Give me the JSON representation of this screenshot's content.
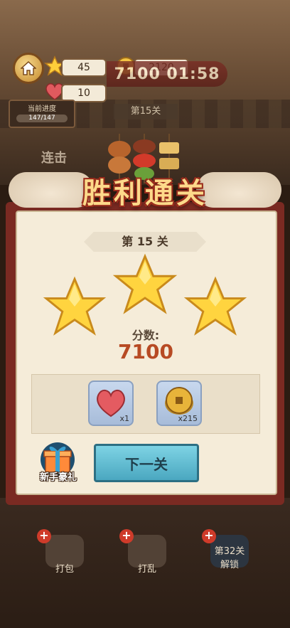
{
  "hud": {
    "stars": "45",
    "coins": "2120",
    "hearts": "10",
    "score_banner": "7100 01:58",
    "progress_label": "当前进度",
    "progress_value": "147/147",
    "level_label": "第15关"
  },
  "background": {
    "combo_text": "连击"
  },
  "result": {
    "title": "胜利通关",
    "level": "第 15 关",
    "stars_earned": 3,
    "score_label": "分数:",
    "score_value": "7100",
    "rewards": [
      {
        "item": "heart-icon",
        "qty": "x1"
      },
      {
        "item": "coin-icon",
        "qty": "x215"
      }
    ],
    "gift_label": "新手豪礼",
    "next_button": "下一关"
  },
  "tools": [
    {
      "label": "打包"
    },
    {
      "label": "打乱"
    },
    {
      "label": "第32关\n解锁"
    }
  ],
  "colors": {
    "frame": "#7a2a22",
    "panel": "#f5ecd9",
    "score": "#b74a23",
    "next_button": "#4aa7c0"
  }
}
